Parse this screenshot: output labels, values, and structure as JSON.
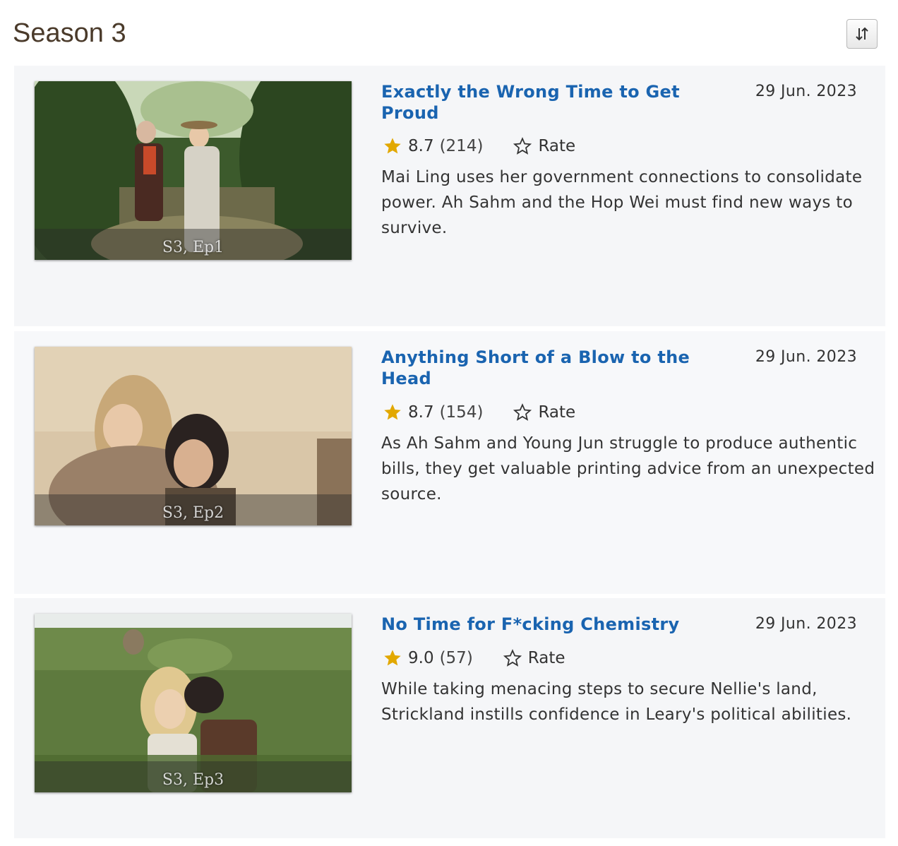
{
  "season": {
    "title": "Season 3"
  },
  "sort": {
    "icon": "sort-arrows-icon"
  },
  "colors": {
    "title_link": "#1a64b0",
    "star": "#f5c518",
    "accent_star": "#e2a800"
  },
  "episodes": [
    {
      "title": "Exactly the Wrong Time to Get Proud",
      "date": "29 Jun. 2023",
      "rating": "8.7",
      "votes": "(214)",
      "rate_label": "Rate",
      "description": "Mai Ling uses her government connections to consolidate power. Ah Sahm and the Hop Wei must find new ways to survive.",
      "episode_label": "S3, Ep1"
    },
    {
      "title": "Anything Short of a Blow to the Head",
      "date": "29 Jun. 2023",
      "rating": "8.7",
      "votes": "(154)",
      "rate_label": "Rate",
      "description": "As Ah Sahm and Young Jun struggle to produce authentic bills, they get valuable printing advice from an unexpected source.",
      "episode_label": "S3, Ep2"
    },
    {
      "title": "No Time for F*cking Chemistry",
      "date": "29 Jun. 2023",
      "rating": "9.0",
      "votes": "(57)",
      "rate_label": "Rate",
      "description": "While taking menacing steps to secure Nellie's land, Strickland instills confidence in Leary's political abilities.",
      "episode_label": "S3, Ep3"
    }
  ]
}
